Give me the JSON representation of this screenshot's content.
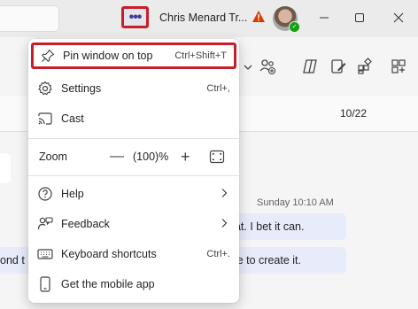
{
  "titlebar": {
    "more_label": "•••",
    "user_name": "Chris Menard Tr..."
  },
  "subbar": {
    "page_count": "10/22"
  },
  "chat": {
    "timestamp": "Sunday 10:10 AM",
    "messages": [
      {
        "text": "hat. I bet it can."
      },
      {
        "text": "ble to create it."
      },
      {
        "text": "ond t"
      }
    ]
  },
  "menu": {
    "items": [
      {
        "label": "Pin window on top",
        "shortcut": "Ctrl+Shift+T",
        "icon": "pin-icon"
      },
      {
        "label": "Settings",
        "shortcut": "Ctrl+,",
        "icon": "settings-icon"
      },
      {
        "label": "Cast",
        "shortcut": "",
        "icon": "cast-icon"
      },
      {
        "label": "Help",
        "shortcut": "",
        "icon": "help-icon"
      },
      {
        "label": "Feedback",
        "shortcut": "",
        "icon": "feedback-icon"
      },
      {
        "label": "Keyboard shortcuts",
        "shortcut": "Ctrl+.",
        "icon": "keyboard-icon"
      },
      {
        "label": "Get the mobile app",
        "shortcut": "",
        "icon": "phone-icon"
      }
    ],
    "zoom": {
      "label": "Zoom",
      "value": "(100)%",
      "minus": "—",
      "plus": "+"
    }
  },
  "colors": {
    "highlight_border": "#c81e2a",
    "accent": "#5b5fc7",
    "bubble": "#e8ebfa",
    "presence": "#13a10e",
    "warning": "#d83b01"
  }
}
